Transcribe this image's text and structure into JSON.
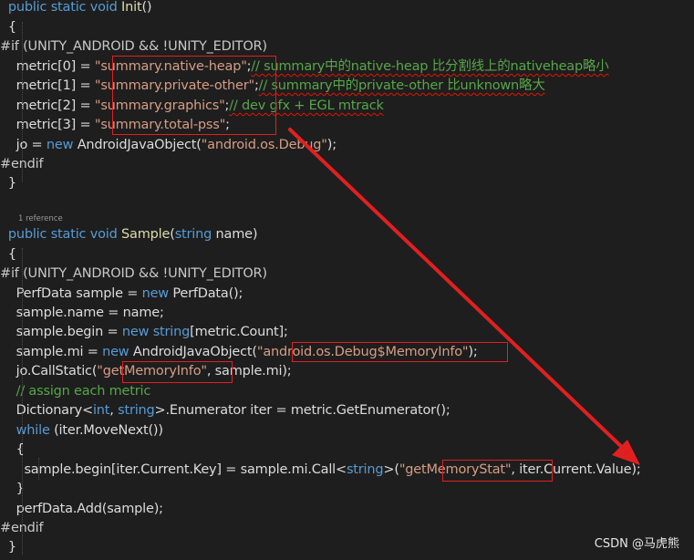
{
  "code": {
    "lines": [
      [
        {
          "t": "  ",
          "c": "plain"
        },
        {
          "t": "public",
          "c": "kw"
        },
        {
          "t": " ",
          "c": "plain"
        },
        {
          "t": "static",
          "c": "kw"
        },
        {
          "t": " ",
          "c": "plain"
        },
        {
          "t": "void",
          "c": "kw"
        },
        {
          "t": " ",
          "c": "plain"
        },
        {
          "t": "Init",
          "c": "fn"
        },
        {
          "t": "()",
          "c": "plain"
        }
      ],
      [
        {
          "t": "  {",
          "c": "plain"
        }
      ],
      [
        {
          "t": "#if (UNITY_ANDROID && !UNITY_EDITOR)",
          "c": "pp"
        }
      ],
      [
        {
          "t": "    metric[0] = ",
          "c": "plain"
        },
        {
          "t": "\"summary.native-heap\"",
          "c": "str"
        },
        {
          "t": ";",
          "c": "plain"
        },
        {
          "t": "// summary中的native-heap 比分割线上的nativeheap略小",
          "c": "cm",
          "sq": true
        }
      ],
      [
        {
          "t": "    metric[1] = ",
          "c": "plain"
        },
        {
          "t": "\"summary.private-other\"",
          "c": "str"
        },
        {
          "t": ";",
          "c": "plain"
        },
        {
          "t": "// summary中的private-other 比unknown略大",
          "c": "cm",
          "sq": true
        }
      ],
      [
        {
          "t": "    metric[2] = ",
          "c": "plain"
        },
        {
          "t": "\"summary.graphics\"",
          "c": "str"
        },
        {
          "t": ";",
          "c": "plain"
        },
        {
          "t": "// dev gfx + EGL mtrack",
          "c": "cm",
          "sq": true
        }
      ],
      [
        {
          "t": "    metric[3] = ",
          "c": "plain"
        },
        {
          "t": "\"summary.total-pss\"",
          "c": "str"
        },
        {
          "t": ";",
          "c": "plain"
        }
      ],
      [
        {
          "t": "    jo = ",
          "c": "plain"
        },
        {
          "t": "new",
          "c": "kw"
        },
        {
          "t": " AndroidJavaObject(",
          "c": "plain"
        },
        {
          "t": "\"android.os.Debug\"",
          "c": "str"
        },
        {
          "t": ");",
          "c": "plain"
        }
      ],
      [
        {
          "t": "#endif",
          "c": "pp"
        }
      ],
      [
        {
          "t": "  }",
          "c": "plain"
        }
      ],
      [],
      [
        {
          "t": "  ",
          "c": "plain"
        },
        {
          "t": "public",
          "c": "kw"
        },
        {
          "t": " ",
          "c": "plain"
        },
        {
          "t": "static",
          "c": "kw"
        },
        {
          "t": " ",
          "c": "plain"
        },
        {
          "t": "void",
          "c": "kw"
        },
        {
          "t": " ",
          "c": "plain"
        },
        {
          "t": "Sample",
          "c": "fn"
        },
        {
          "t": "(",
          "c": "plain"
        },
        {
          "t": "string",
          "c": "kw"
        },
        {
          "t": " name)",
          "c": "plain"
        }
      ],
      [
        {
          "t": "  {",
          "c": "plain"
        }
      ],
      [
        {
          "t": "#if (UNITY_ANDROID && !UNITY_EDITOR)",
          "c": "pp"
        }
      ],
      [
        {
          "t": "    PerfData sample = ",
          "c": "plain"
        },
        {
          "t": "new",
          "c": "kw"
        },
        {
          "t": " PerfData();",
          "c": "plain"
        }
      ],
      [
        {
          "t": "    sample.name = name;",
          "c": "plain"
        }
      ],
      [
        {
          "t": "    sample.begin = ",
          "c": "plain"
        },
        {
          "t": "new",
          "c": "kw"
        },
        {
          "t": " ",
          "c": "plain"
        },
        {
          "t": "string",
          "c": "kw"
        },
        {
          "t": "[metric.Count];",
          "c": "plain"
        }
      ],
      [
        {
          "t": "    sample.mi = ",
          "c": "plain"
        },
        {
          "t": "new",
          "c": "kw"
        },
        {
          "t": " AndroidJavaObject(",
          "c": "plain"
        },
        {
          "t": "\"android.os.Debug$MemoryInfo\"",
          "c": "str"
        },
        {
          "t": ");",
          "c": "plain"
        }
      ],
      [
        {
          "t": "    jo.CallStatic(",
          "c": "plain"
        },
        {
          "t": "\"getMemoryInfo\"",
          "c": "str"
        },
        {
          "t": ", sample.mi);",
          "c": "plain"
        }
      ],
      [
        {
          "t": "    ",
          "c": "plain"
        },
        {
          "t": "// assign each metric",
          "c": "cm"
        }
      ],
      [
        {
          "t": "    Dictionary<",
          "c": "plain"
        },
        {
          "t": "int",
          "c": "kw"
        },
        {
          "t": ", ",
          "c": "plain"
        },
        {
          "t": "string",
          "c": "kw"
        },
        {
          "t": ">.Enumerator iter = metric.GetEnumerator();",
          "c": "plain"
        }
      ],
      [
        {
          "t": "    ",
          "c": "plain"
        },
        {
          "t": "while",
          "c": "kw"
        },
        {
          "t": " (iter.MoveNext())",
          "c": "plain"
        }
      ],
      [
        {
          "t": "    {",
          "c": "plain"
        }
      ],
      [
        {
          "t": "      sample.begin[iter.Current.Key] = sample.mi.Call<",
          "c": "plain"
        },
        {
          "t": "string",
          "c": "kw"
        },
        {
          "t": ">(",
          "c": "plain"
        },
        {
          "t": "\"getMemoryStat\"",
          "c": "str"
        },
        {
          "t": ", iter.Current.Value);",
          "c": "plain"
        }
      ],
      [
        {
          "t": "    }",
          "c": "plain"
        }
      ],
      [
        {
          "t": "    perfData.Add(sample);",
          "c": "plain"
        }
      ],
      [
        {
          "t": "#endif",
          "c": "pp"
        }
      ],
      [
        {
          "t": "  }",
          "c": "plain"
        }
      ]
    ],
    "reference_label": "1 reference"
  },
  "annotation": {
    "color": "#e02020"
  },
  "watermark": "CSDN @马虎熊",
  "colors": {
    "background": "#1e1e1e",
    "keyword": "#569cd6",
    "string": "#d69d85",
    "comment": "#57a64a",
    "method": "#dcdcaa",
    "text": "#dcdcdc",
    "annotation": "#e02020"
  }
}
